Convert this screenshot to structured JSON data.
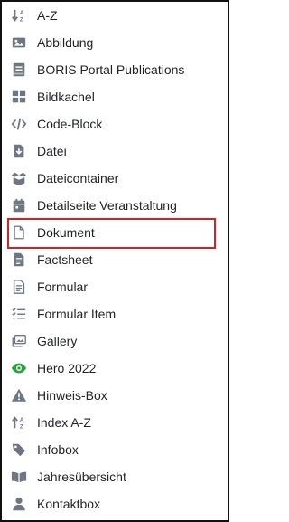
{
  "items": [
    {
      "label": "A-Z",
      "icon": "sort-az-icon"
    },
    {
      "label": "Abbildung",
      "icon": "image-icon"
    },
    {
      "label": "BORIS Portal Publications",
      "icon": "book-icon"
    },
    {
      "label": "Bildkachel",
      "icon": "tiles-icon"
    },
    {
      "label": "Code-Block",
      "icon": "code-icon"
    },
    {
      "label": "Datei",
      "icon": "file-download-icon"
    },
    {
      "label": "Dateicontainer",
      "icon": "box-open-icon"
    },
    {
      "label": "Detailseite Veranstaltung",
      "icon": "calendar-icon"
    },
    {
      "label": "Dokument",
      "icon": "document-icon"
    },
    {
      "label": "Factsheet",
      "icon": "file-lines-icon"
    },
    {
      "label": "Formular",
      "icon": "form-icon"
    },
    {
      "label": "Formular Item",
      "icon": "list-check-icon"
    },
    {
      "label": "Gallery",
      "icon": "images-icon"
    },
    {
      "label": "Hero 2022",
      "icon": "eye-icon"
    },
    {
      "label": "Hinweis-Box",
      "icon": "warning-icon"
    },
    {
      "label": "Index A-Z",
      "icon": "sort-index-icon"
    },
    {
      "label": "Infobox",
      "icon": "tag-icon"
    },
    {
      "label": "Jahresübersicht",
      "icon": "open-book-icon"
    },
    {
      "label": "Kontaktbox",
      "icon": "user-icon"
    }
  ],
  "selected_index": 8,
  "colors": {
    "icon": "#6e7681",
    "hero_icon": "#2ea043",
    "highlight": "#d42027",
    "text": "#1f2328"
  }
}
